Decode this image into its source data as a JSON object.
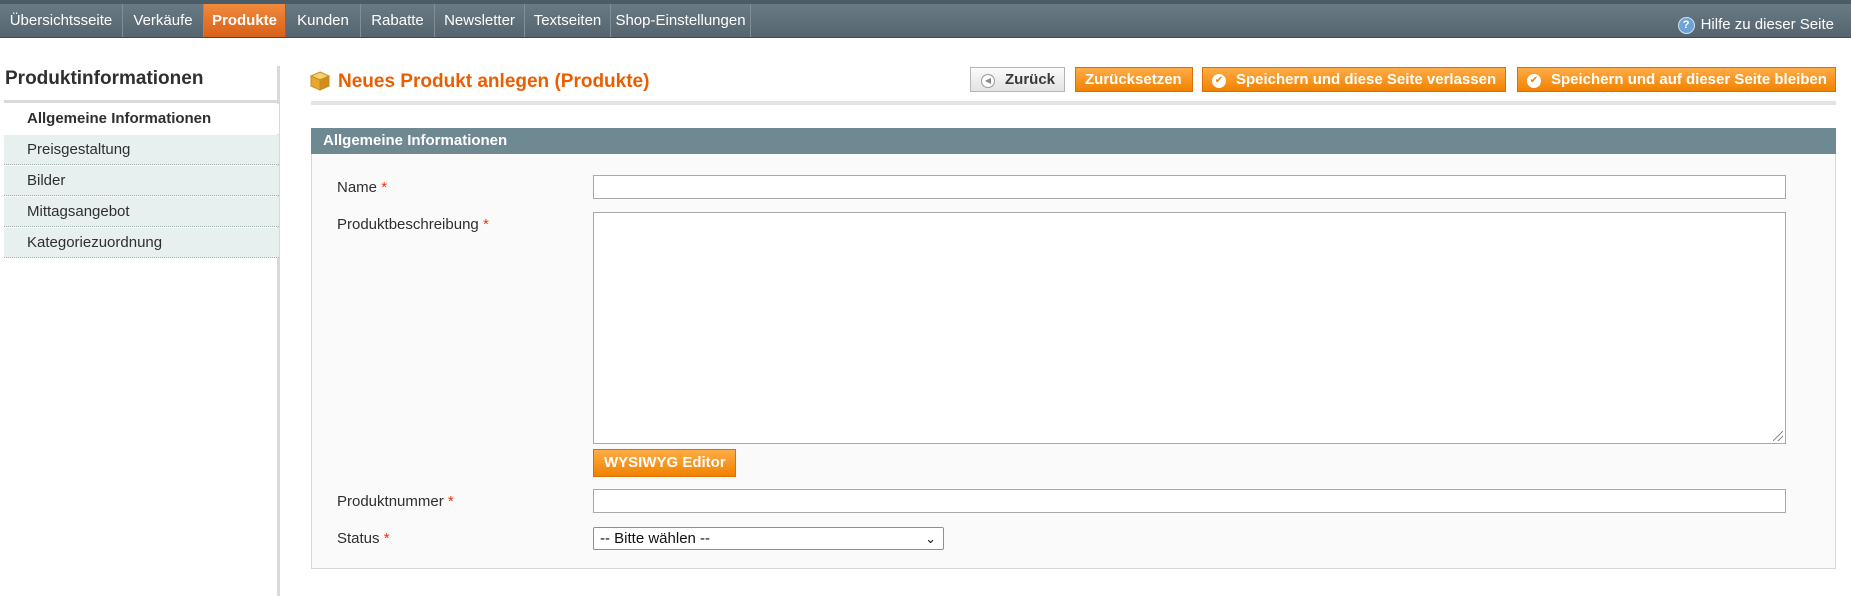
{
  "nav": {
    "items": [
      {
        "label": "Übersichtsseite"
      },
      {
        "label": "Verkäufe"
      },
      {
        "label": "Produkte",
        "active": true
      },
      {
        "label": "Kunden"
      },
      {
        "label": "Rabatte"
      },
      {
        "label": "Newsletter"
      },
      {
        "label": "Textseiten"
      },
      {
        "label": "Shop-Einstellungen"
      }
    ],
    "help_label": "Hilfe zu dieser Seite",
    "help_icon": "question-circle-icon"
  },
  "sidebar": {
    "title": "Produktinformationen",
    "items": [
      {
        "label": "Allgemeine Informationen",
        "active": true
      },
      {
        "label": "Preisgestaltung"
      },
      {
        "label": "Bilder"
      },
      {
        "label": "Mittagsangebot"
      },
      {
        "label": "Kategoriezuordnung"
      }
    ]
  },
  "header": {
    "title": "Neues Produkt anlegen (Produkte)",
    "title_icon": "product-box-icon",
    "buttons": {
      "back": "Zurück",
      "reset": "Zurücksetzen",
      "save_exit": "Speichern und diese Seite verlassen",
      "save_stay": "Speichern und auf dieser Seite bleiben"
    }
  },
  "form": {
    "section_title": "Allgemeine Informationen",
    "required_marker": "*",
    "fields": {
      "name": {
        "label": "Name",
        "value": ""
      },
      "description": {
        "label": "Produktbeschreibung",
        "value": ""
      },
      "sku": {
        "label": "Produktnummer",
        "value": ""
      },
      "status": {
        "label": "Status",
        "selected": "-- Bitte wählen --"
      }
    },
    "wysiwyg_label": "WYSIWYG Editor"
  },
  "colors": {
    "accent_orange": "#f18200",
    "title_orange": "#eb5e00",
    "nav_bg": "#5f6f79",
    "section_head_bg": "#6f8992",
    "required_red": "#eb340a"
  }
}
